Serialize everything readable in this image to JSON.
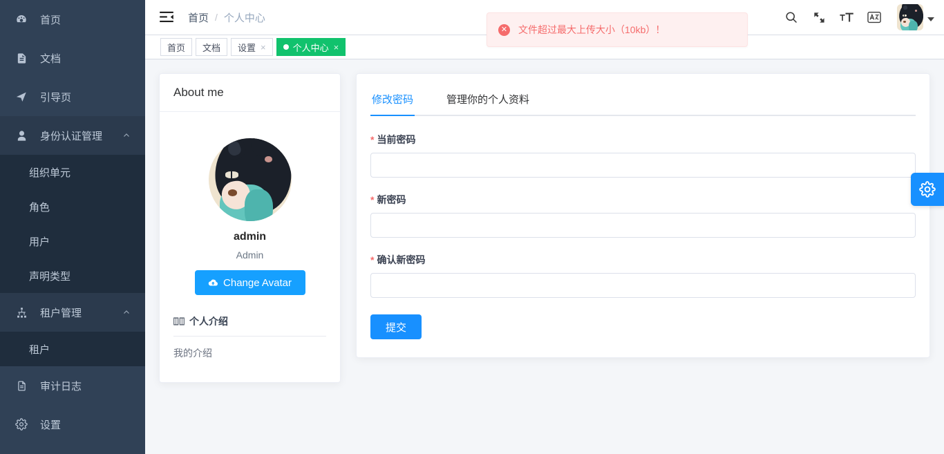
{
  "sidebar": {
    "items": [
      {
        "label": "首页",
        "icon": "dashboard-icon",
        "type": "link"
      },
      {
        "label": "文档",
        "icon": "document-icon",
        "type": "link"
      },
      {
        "label": "引导页",
        "icon": "guide-send-icon",
        "type": "link"
      },
      {
        "label": "身份认证管理",
        "icon": "user-icon",
        "type": "group",
        "expanded": true,
        "children": [
          {
            "label": "组织单元"
          },
          {
            "label": "角色"
          },
          {
            "label": "用户"
          },
          {
            "label": "声明类型"
          }
        ]
      },
      {
        "label": "租户管理",
        "icon": "sitemap-icon",
        "type": "group",
        "expanded": true,
        "children": [
          {
            "label": "租户"
          }
        ]
      },
      {
        "label": "审计日志",
        "icon": "document-icon",
        "type": "link"
      },
      {
        "label": "设置",
        "icon": "gear-icon",
        "type": "link"
      }
    ]
  },
  "navbar": {
    "hamburger": "collapse-menu-icon",
    "breadcrumb": [
      {
        "label": "首页",
        "active": true
      },
      {
        "label": "个人中心",
        "active": false
      }
    ],
    "separator": "/",
    "icons": [
      {
        "name": "search-icon"
      },
      {
        "name": "fullscreen-icon"
      },
      {
        "name": "font-size-icon"
      },
      {
        "name": "translate-icon"
      }
    ],
    "avatar_alt": "admin-avatar"
  },
  "tags_view": {
    "tabs": [
      {
        "label": "首页",
        "closable": false,
        "active": false
      },
      {
        "label": "文档",
        "closable": false,
        "active": false
      },
      {
        "label": "设置",
        "closable": true,
        "active": false
      },
      {
        "label": "个人中心",
        "closable": true,
        "active": true
      }
    ],
    "close_glyph": "×"
  },
  "notification": {
    "icon": "error-circle-icon",
    "glyph": "✕",
    "message": "文件超过最大上传大小（10kb）！"
  },
  "about_card": {
    "title": "About me",
    "user_name": "admin",
    "user_role": "Admin",
    "change_avatar_label": "Change Avatar",
    "change_avatar_icon": "cloud-upload-icon",
    "intro_title": "个人介绍",
    "intro_icon": "book-icon",
    "intro_text": "我的介绍"
  },
  "settings_card": {
    "tabs": [
      {
        "label": "修改密码",
        "active": true
      },
      {
        "label": "管理你的个人资料",
        "active": false
      }
    ],
    "form": {
      "fields": [
        {
          "label": "当前密码",
          "required": true,
          "value": "",
          "placeholder": ""
        },
        {
          "label": "新密码",
          "required": true,
          "value": "",
          "placeholder": ""
        },
        {
          "label": "确认新密码",
          "required": true,
          "value": "",
          "placeholder": ""
        }
      ],
      "submit_label": "提交"
    }
  },
  "fab": {
    "icon": "gear-icon",
    "name": "theme-settings-button"
  },
  "colors": {
    "sidebar_bg": "#304156",
    "submenu_bg": "#1f2d3d",
    "accent_blue": "#1890ff",
    "tab_active_green": "#11c26d",
    "error_red": "#f56c6c",
    "content_bg": "#f4f6f9"
  }
}
